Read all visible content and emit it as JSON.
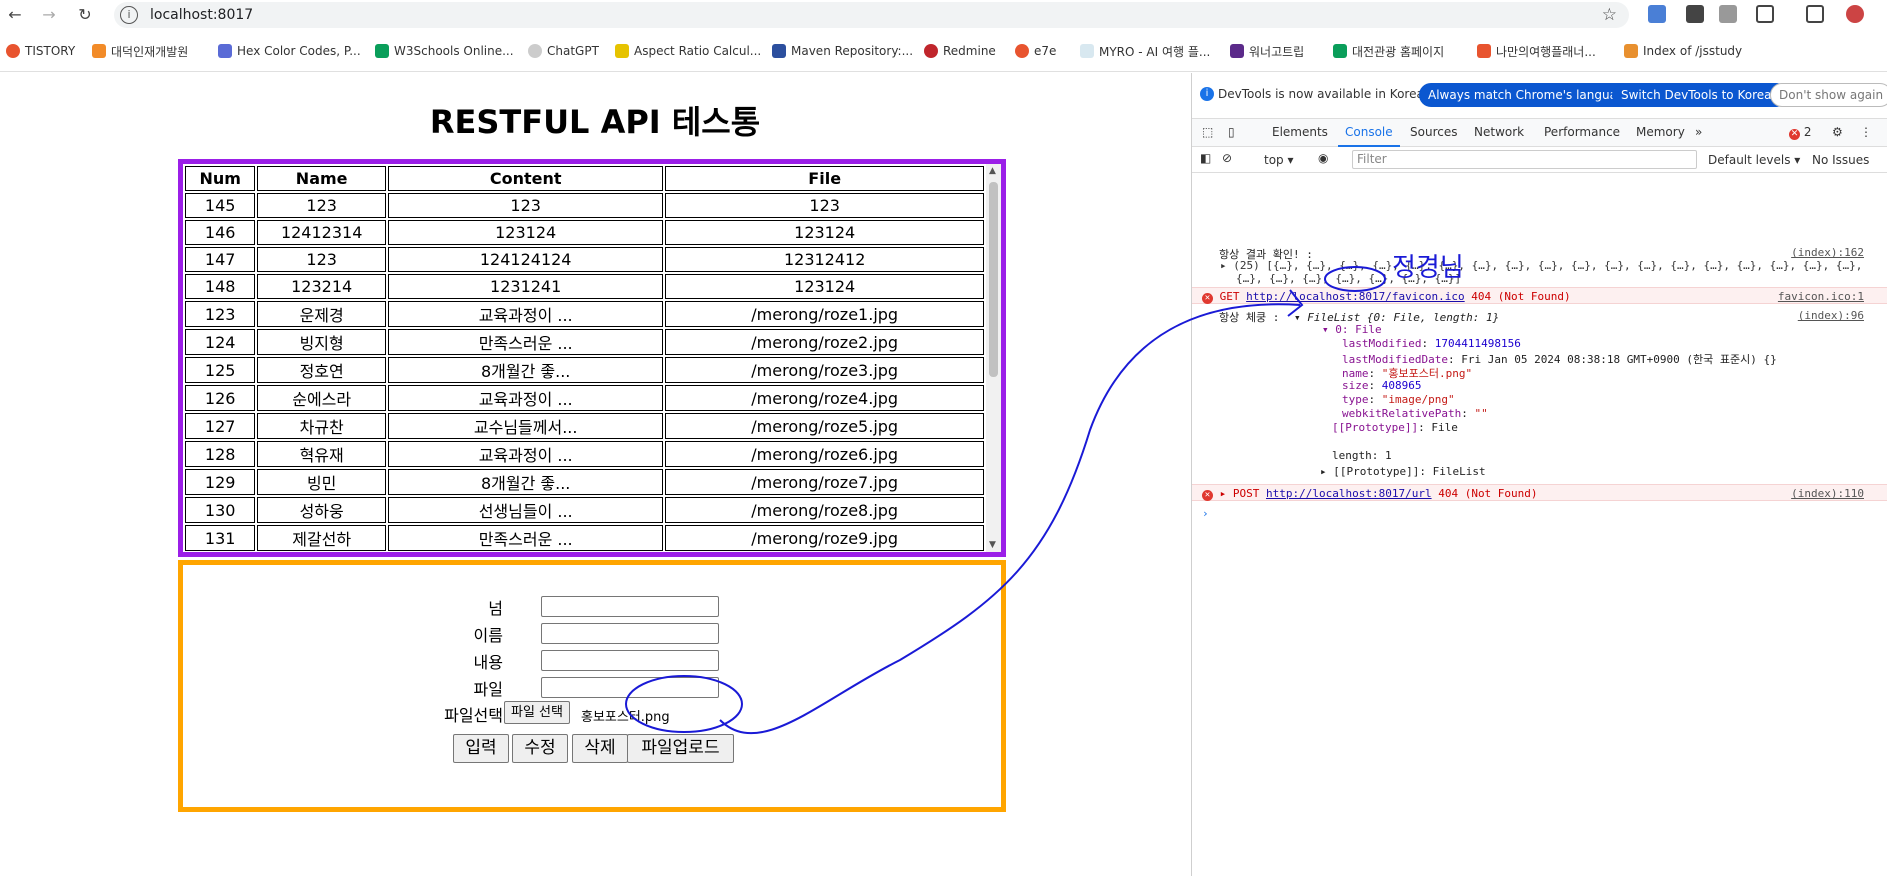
{
  "browser": {
    "url": "localhost:8017",
    "bookmarks": [
      "TISTORY",
      "대덕인재개발원",
      "Hex Color Codes, P...",
      "W3Schools Online...",
      "ChatGPT",
      "Aspect Ratio Calcul...",
      "Maven Repository:...",
      "Redmine",
      "e7e",
      "MYRO - AI 여행 플...",
      "워너고트립",
      "대전관광 홈페이지",
      "나만의여행플래너...",
      "Index of /jsstudy"
    ]
  },
  "page": {
    "title": "RESTFUL API 테스통",
    "table": {
      "headers": [
        "Num",
        "Name",
        "Content",
        "File"
      ],
      "rows": [
        [
          "145",
          "123",
          "123",
          "123"
        ],
        [
          "146",
          "12412314",
          "123124",
          "123124"
        ],
        [
          "147",
          "123",
          "124124124",
          "12312412"
        ],
        [
          "148",
          "123214",
          "1231241",
          "123124"
        ],
        [
          "123",
          "운제경",
          "교육과정이 ...",
          "/merong/roze1.jpg"
        ],
        [
          "124",
          "빙지형",
          "만족스러운 ...",
          "/merong/roze2.jpg"
        ],
        [
          "125",
          "정호연",
          "8개월간 좋...",
          "/merong/roze3.jpg"
        ],
        [
          "126",
          "순에스라",
          "교육과정이 ...",
          "/merong/roze4.jpg"
        ],
        [
          "127",
          "차규찬",
          "교수님들께서...",
          "/merong/roze5.jpg"
        ],
        [
          "128",
          "혁유재",
          "교육과정이 ...",
          "/merong/roze6.jpg"
        ],
        [
          "129",
          "빙민",
          "8개월간 좋...",
          "/merong/roze7.jpg"
        ],
        [
          "130",
          "성하웅",
          "선생님들이 ...",
          "/merong/roze8.jpg"
        ],
        [
          "131",
          "제갈선하",
          "만족스러운 ...",
          "/merong/roze9.jpg"
        ]
      ]
    },
    "form": {
      "labels": [
        "넘",
        "이름",
        "내용",
        "파일",
        "파일선택"
      ],
      "file_button": "파일 선택",
      "file_name": "홍보포스터.png",
      "buttons": [
        "입력",
        "수정",
        "삭제",
        "파일업로드"
      ]
    }
  },
  "devtools": {
    "info_text": "DevTools is now available in Korean!",
    "info_buttons": [
      "Always match Chrome's language",
      "Switch DevTools to Korean",
      "Don't show again"
    ],
    "tabs": [
      "Elements",
      "Console",
      "Sources",
      "Network",
      "Performance",
      "Memory"
    ],
    "active_tab": "Console",
    "error_count": "2",
    "context": "top",
    "filter_placeholder": "Filter",
    "levels": "Default levels",
    "issues": "No Issues",
    "console": {
      "line1_label": "항상 결과 확인! :",
      "line1_src": "(index):162",
      "line1_value": "(25) [{…}, {…}, {…}, {…}, {…}, {…}, {…}, {…}, {…}, {…}, {…}, {…}, {…}, {…}, {…}, {…}, {…}, {…},",
      "line1_value2": "{…}, {…}, {…}, {…}, {…}, {…}, {…}]",
      "err1_method": "GET",
      "err1_url": "http://localhost:8017/favicon.ico",
      "err1_status": "404 (Not Found)",
      "err1_src": "favicon.ico:1",
      "line2_label": "항상 체쿵 :",
      "line2_value": "FileList {0: File, length: 1}",
      "line2_src": "(index):96",
      "file_key": "0: File",
      "props": [
        {
          "k": "lastModified",
          "v": "1704411498156"
        },
        {
          "k": "lastModifiedDate",
          "v": "Fri Jan 05 2024 08:38:18 GMT+0900 (한국 표준시) {}"
        },
        {
          "k": "name",
          "v": "\"홍보포스터.png\""
        },
        {
          "k": "size",
          "v": "408965"
        },
        {
          "k": "type",
          "v": "\"image/png\""
        },
        {
          "k": "webkitRelativePath",
          "v": "\"\""
        },
        {
          "k": "[[Prototype]]",
          "v": "File"
        }
      ],
      "length_line": "length: 1",
      "proto_line": "[[Prototype]]: FileList",
      "err2_method": "POST",
      "err2_url": "http://localhost:8017/url",
      "err2_status": "404 (Not Found)",
      "err2_src": "(index):110",
      "annotation": "정경님"
    }
  },
  "colors": {
    "table_border": "#9b1fe8",
    "form_border": "#ffa500",
    "annotation": "#1a1ad6"
  }
}
